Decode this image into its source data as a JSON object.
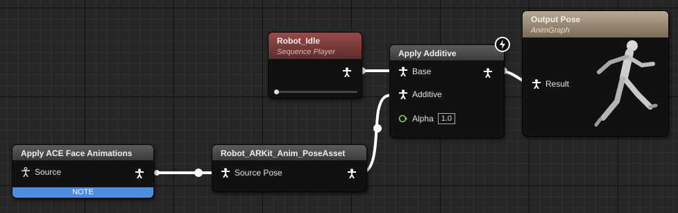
{
  "nodes": {
    "face": {
      "title": "Apply ACE Face Animations",
      "pin_source": "Source",
      "note": "NOTE"
    },
    "poseasset": {
      "title": "Robot_ARKit_Anim_PoseAsset",
      "pin_source_pose": "Source Pose"
    },
    "idle": {
      "title": "Robot_Idle",
      "subtitle": "Sequence Player"
    },
    "additive": {
      "title": "Apply Additive",
      "pin_base": "Base",
      "pin_additive": "Additive",
      "pin_alpha": "Alpha",
      "alpha_value": "1.0"
    },
    "output": {
      "title": "Output Pose",
      "subtitle": "AnimGraph",
      "pin_result": "Result"
    }
  },
  "colors": {
    "note_bar": "#4f8ddf",
    "idle_header": "#9a4a4a",
    "output_header": "#b8a892",
    "alpha_pin": "#7fd35a"
  }
}
